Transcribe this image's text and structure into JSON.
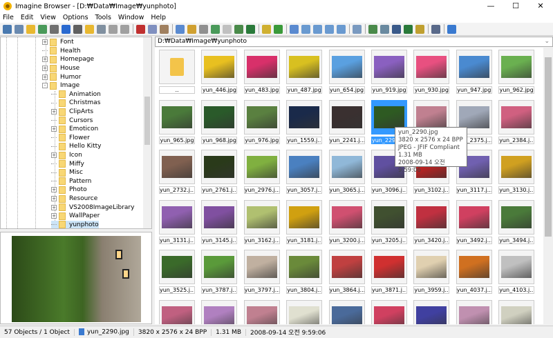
{
  "window": {
    "title": "Imagine Browser - [D:₩Data₩Image₩yunphoto]",
    "minimize": "—",
    "maximize": "☐",
    "close": "✕"
  },
  "menu": [
    "File",
    "Edit",
    "View",
    "Options",
    "Tools",
    "Window",
    "Help"
  ],
  "toolbar": {
    "icons": [
      "view-icon",
      "slideshow-icon",
      "open-folder-icon",
      "copy-to-icon",
      "print-icon",
      "info-icon",
      "scan-icon",
      "new-folder-icon",
      "move-icon",
      "delete-icon",
      "properties-icon",
      "cut-icon",
      "copy-icon",
      "paste-icon",
      "window-icon",
      "tree-icon",
      "history-icon",
      "favorites-icon",
      "grid-icon",
      "preview-icon",
      "map-icon",
      "folder-up-icon",
      "refresh-icon",
      "thumbnails-icon",
      "large-icons-icon",
      "small-icons-icon",
      "list-icon",
      "details-icon",
      "settings-icon",
      "convert-icon",
      "batch-icon",
      "capture-icon",
      "filmstrip-icon",
      "edit-icon",
      "fullscreen-icon",
      "help-icon"
    ]
  },
  "tree": [
    {
      "label": "Font",
      "level": 0,
      "expand": "+"
    },
    {
      "label": "Health",
      "level": 0,
      "expand": ""
    },
    {
      "label": "Homepage",
      "level": 0,
      "expand": "+"
    },
    {
      "label": "House",
      "level": 0,
      "expand": "+"
    },
    {
      "label": "Humor",
      "level": 0,
      "expand": "+"
    },
    {
      "label": "Image",
      "level": 0,
      "expand": "-"
    },
    {
      "label": "Animation",
      "level": 1,
      "expand": ""
    },
    {
      "label": "Christmas",
      "level": 1,
      "expand": ""
    },
    {
      "label": "ClipArts",
      "level": 1,
      "expand": "+"
    },
    {
      "label": "Cursors",
      "level": 1,
      "expand": ""
    },
    {
      "label": "Emoticon",
      "level": 1,
      "expand": "+"
    },
    {
      "label": "Flower",
      "level": 1,
      "expand": ""
    },
    {
      "label": "Hello Kitty",
      "level": 1,
      "expand": ""
    },
    {
      "label": "Icon",
      "level": 1,
      "expand": "+"
    },
    {
      "label": "Miffy",
      "level": 1,
      "expand": ""
    },
    {
      "label": "Misc",
      "level": 1,
      "expand": ""
    },
    {
      "label": "Pattern",
      "level": 1,
      "expand": ""
    },
    {
      "label": "Photo",
      "level": 1,
      "expand": "+"
    },
    {
      "label": "Resource",
      "level": 1,
      "expand": "+"
    },
    {
      "label": "VS2008ImageLibrary",
      "level": 1,
      "expand": "+"
    },
    {
      "label": "WallPaper",
      "level": 1,
      "expand": "+"
    },
    {
      "label": "yunphoto",
      "level": 1,
      "expand": "",
      "selected": true
    }
  ],
  "address": "D:₩Data₩Image₩yunphoto",
  "files": [
    {
      "name": "..",
      "color": "#f3c44a"
    },
    {
      "name": "yun_446.jpg",
      "color": "#e8c020"
    },
    {
      "name": "yun_483.jpg",
      "color": "#d8306a"
    },
    {
      "name": "yun_487.jpg",
      "color": "#d8c020"
    },
    {
      "name": "yun_654.jpg",
      "color": "#5aa0e0"
    },
    {
      "name": "yun_919.jpg",
      "color": "#8a60c0"
    },
    {
      "name": "yun_930.jpg",
      "color": "#e85080"
    },
    {
      "name": "yun_947.jpg",
      "color": "#4a8ad0"
    },
    {
      "name": "yun_962.jpg",
      "color": "#6ab050"
    },
    {
      "name": "yun_965.jpg",
      "color": "#4a7a3a"
    },
    {
      "name": "yun_968.jpg",
      "color": "#2a5a2a"
    },
    {
      "name": "yun_976.jpg",
      "color": "#5a8040"
    },
    {
      "name": "yun_1559.j...",
      "color": "#1a2a4a"
    },
    {
      "name": "yun_2241.j...",
      "color": "#3a3030"
    },
    {
      "name": "yun_2290.jpg",
      "color": "#2e5a22",
      "selected": true
    },
    {
      "name": "",
      "color": "#c08090"
    },
    {
      "name": "yun_2375.j...",
      "color": "#a0a8b8"
    },
    {
      "name": "yun_2384.j...",
      "color": "#d06080"
    },
    {
      "name": "yun_2732.j...",
      "color": "#806050"
    },
    {
      "name": "yun_2761.j...",
      "color": "#2a3a1a"
    },
    {
      "name": "yun_2976.j...",
      "color": "#80b040"
    },
    {
      "name": "yun_3057.j...",
      "color": "#4a80c0"
    },
    {
      "name": "yun_3065.j...",
      "color": "#90b8d8"
    },
    {
      "name": "yun_3096.j...",
      "color": "#6050a0"
    },
    {
      "name": "yun_3102.j...",
      "color": "#c02020"
    },
    {
      "name": "yun_3117.j...",
      "color": "#7060b0"
    },
    {
      "name": "yun_3130.j...",
      "color": "#d0a020"
    },
    {
      "name": "yun_3131.j...",
      "color": "#9060b0"
    },
    {
      "name": "yun_3145.j...",
      "color": "#8050a0"
    },
    {
      "name": "yun_3162.j...",
      "color": "#b0c070"
    },
    {
      "name": "yun_3181.j...",
      "color": "#d0a010"
    },
    {
      "name": "yun_3200.j...",
      "color": "#d05070"
    },
    {
      "name": "yun_3205.j...",
      "color": "#405030"
    },
    {
      "name": "yun_3420.j...",
      "color": "#c03040"
    },
    {
      "name": "yun_3492.j...",
      "color": "#d04060"
    },
    {
      "name": "yun_3494.j...",
      "color": "#4a7a3a"
    },
    {
      "name": "yun_3525.j...",
      "color": "#3a6a2a"
    },
    {
      "name": "yun_3787.j...",
      "color": "#5a9a3a"
    },
    {
      "name": "yun_3797.j...",
      "color": "#c0b0a0"
    },
    {
      "name": "yun_3804.j...",
      "color": "#6a8a3a"
    },
    {
      "name": "yun_3864.j...",
      "color": "#c04040"
    },
    {
      "name": "yun_3871.j...",
      "color": "#d03030"
    },
    {
      "name": "yun_3959.j...",
      "color": "#e0d0b0"
    },
    {
      "name": "yun_4037.j...",
      "color": "#d07020"
    },
    {
      "name": "yun_4103.j...",
      "color": "#c0c0c0"
    },
    {
      "name": "",
      "color": "#c06080"
    },
    {
      "name": "",
      "color": "#b080c0"
    },
    {
      "name": "",
      "color": "#c08090"
    },
    {
      "name": "",
      "color": "#e0e0d0"
    },
    {
      "name": "",
      "color": "#4a6a9a"
    },
    {
      "name": "",
      "color": "#d04060"
    },
    {
      "name": "",
      "color": "#4040a0"
    },
    {
      "name": "",
      "color": "#c090b0"
    },
    {
      "name": "",
      "color": "#d0d0c0"
    }
  ],
  "tooltip": {
    "name": "yun_2290.jpg",
    "dims": "3820 x 2576 x 24 BPP",
    "format": "JPEG - JFIF Compliant",
    "size": "1.31 MB",
    "date": "2008-09-14 오전 9:59:06"
  },
  "status": {
    "objects": "57 Objects / 1 Object",
    "file": "yun_2290.jpg",
    "dims": "3820 x 2576 x 24 BPP",
    "size": "1.31 MB",
    "date": "2008-09-14 오전 9:59:06"
  }
}
